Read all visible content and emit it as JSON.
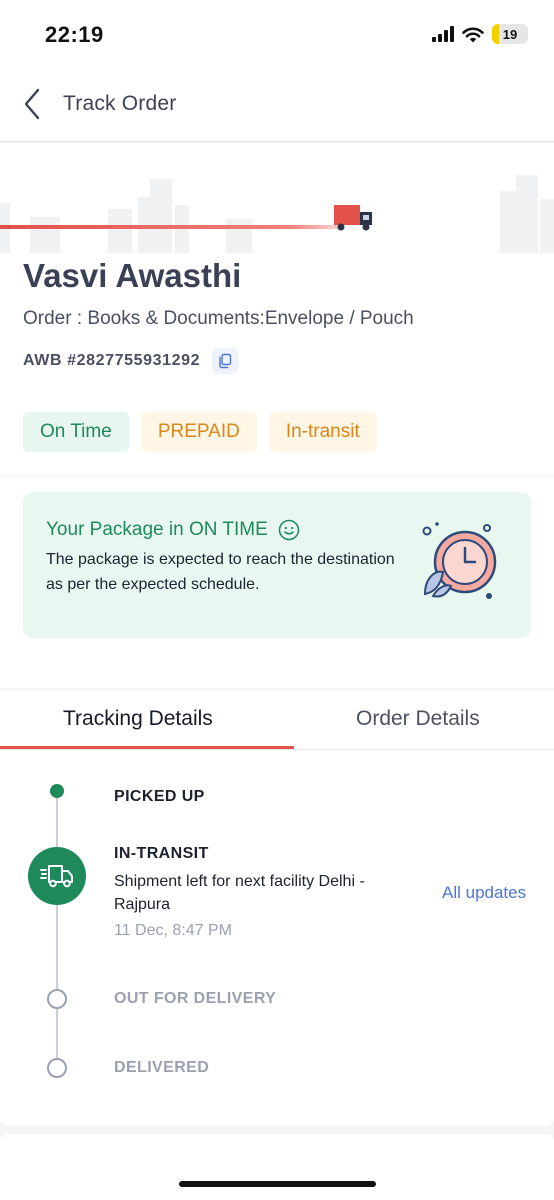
{
  "status_bar": {
    "time": "22:19",
    "battery": "19",
    "battery_level": 0.19
  },
  "header": {
    "title": "Track Order",
    "back_icon": "chevron-left-icon"
  },
  "summary": {
    "customer_name": "Vasvi Awasthi",
    "order_line": "Order : Books & Documents:Envelope / Pouch",
    "awb": "AWB #2827755931292",
    "badges": [
      {
        "label": "On Time",
        "color": "#1e8a5c"
      },
      {
        "label": "PREPAID",
        "color": "#d9861a"
      },
      {
        "label": "In-transit",
        "color": "#d9861a"
      }
    ]
  },
  "notice": {
    "title": "Your Package in ON TIME",
    "body": "The package is expected to reach the destination as per the expected schedule.",
    "icon": "smile-icon",
    "illustration": "clock-icon"
  },
  "tabs": {
    "tracking": "Tracking Details",
    "order": "Order Details"
  },
  "timeline": {
    "steps": [
      {
        "label": "PICKED UP",
        "state": "done"
      },
      {
        "label": "IN-TRANSIT",
        "state": "current",
        "description": "Shipment left for next facility Delhi - Rajpura",
        "time": "11 Dec, 8:47 PM"
      },
      {
        "label": "OUT FOR DELIVERY",
        "state": "pending"
      },
      {
        "label": "DELIVERED",
        "state": "pending"
      }
    ],
    "all_updates": "All updates"
  },
  "colors": {
    "accent_green": "#1e8a5c",
    "accent_red": "#e2514a",
    "link_blue": "#4c76d6",
    "badge_orange": "#d9861a"
  }
}
